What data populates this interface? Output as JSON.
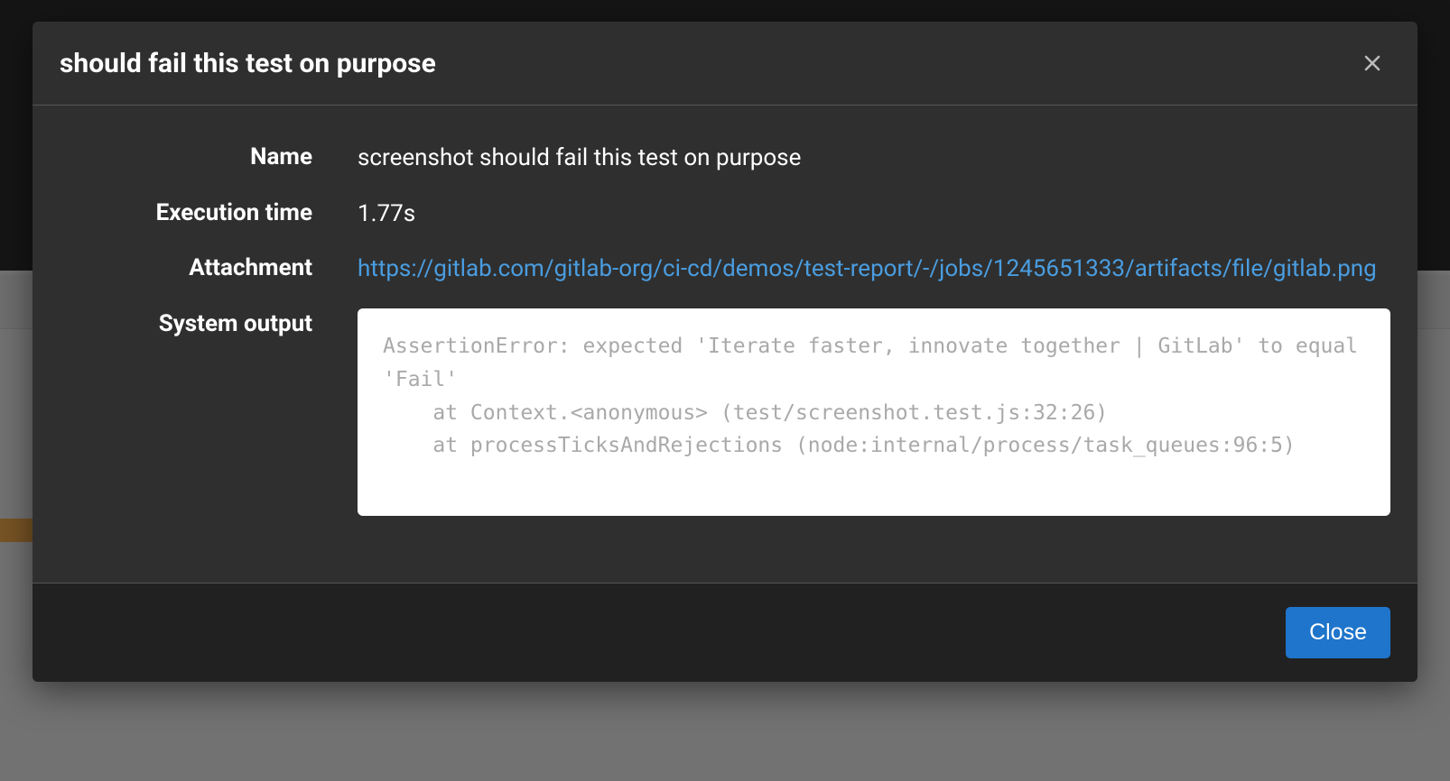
{
  "modal": {
    "title": "should fail this test on purpose",
    "close_btn_label": "Close",
    "fields": {
      "name_label": "Name",
      "name_value": "screenshot should fail this test on purpose",
      "exec_label": "Execution time",
      "exec_value": "1.77s",
      "attach_label": "Attachment",
      "attach_link_text": "https://gitlab.com/gitlab-org/ci-cd/demos/test-report/-/jobs/1245651333/artifacts/file/gitlab.png",
      "sysout_label": "System output",
      "sysout_value": "AssertionError: expected 'Iterate faster, innovate together | GitLab' to equal 'Fail'\n    at Context.<anonymous> (test/screenshot.test.js:32:26)\n    at processTicksAndRejections (node:internal/process/task_queues:96:5)"
    }
  }
}
